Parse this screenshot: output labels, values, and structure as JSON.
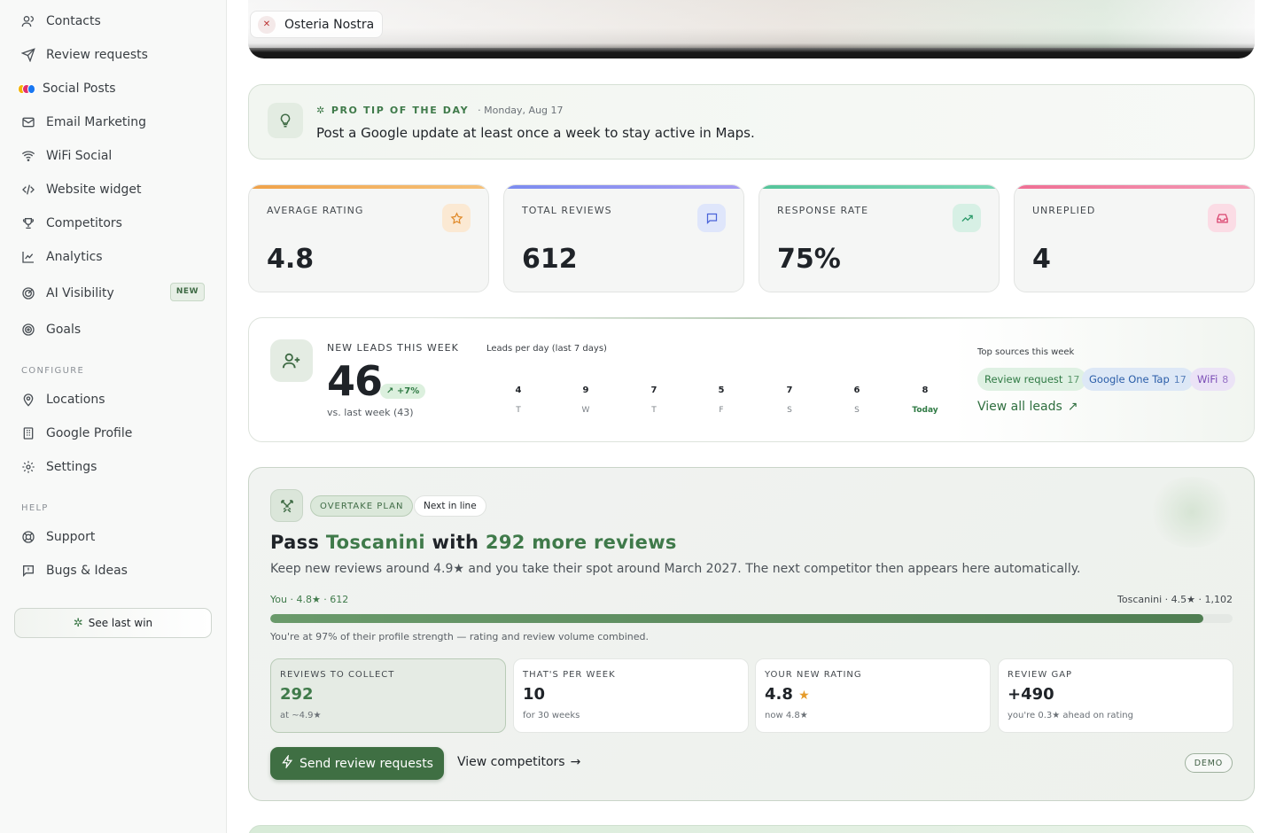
{
  "sidebar": {
    "items": [
      {
        "label": "Contacts",
        "icon": "contacts-icon"
      },
      {
        "label": "Review requests",
        "icon": "send-icon"
      },
      {
        "label": "Social Posts",
        "icon": "social-icons"
      },
      {
        "label": "Email Marketing",
        "icon": "mail-icon"
      },
      {
        "label": "WiFi Social",
        "icon": "wifi-icon"
      },
      {
        "label": "Website widget",
        "icon": "code-icon"
      },
      {
        "label": "Competitors",
        "icon": "trophy-icon"
      },
      {
        "label": "Analytics",
        "icon": "chart-icon"
      },
      {
        "label": "AI Visibility",
        "icon": "target-icon",
        "badge": "NEW"
      },
      {
        "label": "Goals",
        "icon": "goal-icon"
      }
    ],
    "configure_label": "CONFIGURE",
    "configure_items": [
      {
        "label": "Locations",
        "icon": "pin-icon"
      },
      {
        "label": "Google Profile",
        "icon": "building-icon"
      },
      {
        "label": "Settings",
        "icon": "gear-icon"
      }
    ],
    "help_label": "HELP",
    "help_items": [
      {
        "label": "Support",
        "icon": "lifebuoy-icon"
      },
      {
        "label": "Bugs & Ideas",
        "icon": "feedback-icon"
      }
    ],
    "see_last_win": "See last win"
  },
  "header": {
    "location_name": "Osteria Nostra"
  },
  "tip": {
    "label": "PRO TIP OF THE DAY",
    "date": "· Monday, Aug 17",
    "text": "Post a Google update at least once a week to stay active in Maps."
  },
  "stats": [
    {
      "label": "AVERAGE RATING",
      "value": "4.8",
      "color": "#f0a24a",
      "icon": "star-icon"
    },
    {
      "label": "TOTAL REVIEWS",
      "value": "612",
      "color": "#7b8cf0",
      "icon": "message-icon"
    },
    {
      "label": "RESPONSE RATE",
      "value": "75%",
      "color": "#54c49a",
      "icon": "trending-up-icon"
    },
    {
      "label": "UNREPLIED",
      "value": "4",
      "color": "#ef6f94",
      "icon": "inbox-icon"
    }
  ],
  "leads": {
    "label": "NEW LEADS THIS WEEK",
    "count": "46",
    "delta": "+7%",
    "vs": "vs. last week (43)",
    "chart_title": "Leads per day (last 7 days)",
    "days": [
      {
        "v": "4",
        "d": "T"
      },
      {
        "v": "9",
        "d": "W"
      },
      {
        "v": "7",
        "d": "T"
      },
      {
        "v": "5",
        "d": "F"
      },
      {
        "v": "7",
        "d": "S"
      },
      {
        "v": "6",
        "d": "S"
      },
      {
        "v": "8",
        "d": "Today"
      }
    ],
    "sources_title": "Top sources this week",
    "sources": [
      {
        "name": "Review request",
        "count": "17"
      },
      {
        "name": "Google One Tap",
        "count": "17"
      },
      {
        "name": "WiFi",
        "count": "8"
      }
    ],
    "view_all": "View all leads"
  },
  "plan": {
    "chip": "OVERTAKE PLAN",
    "next": "Next in line",
    "title_pre": "Pass ",
    "competitor": "Toscanini",
    "title_mid": " with ",
    "title_end": "292 more reviews",
    "desc": "Keep new reviews around 4.9★ and you take their spot around March 2027. The next competitor then appears here automatically.",
    "you": "You · 4.8★ · 612",
    "them": "Toscanini · 4.5★ · 1,102",
    "progress_percent": 97,
    "progress_note": "You're at 97% of their profile strength — rating and review volume combined.",
    "metrics": [
      {
        "label": "REVIEWS TO COLLECT",
        "value": "292",
        "sub": "at ~4.9★"
      },
      {
        "label": "THAT'S PER WEEK",
        "value": "10",
        "sub": "for 30 weeks"
      },
      {
        "label": "YOUR NEW RATING",
        "value": "4.8",
        "sub": "now 4.8★"
      },
      {
        "label": "REVIEW GAP",
        "value": "+490",
        "sub": "you're 0.3★ ahead on rating"
      }
    ],
    "send_button": "Send review requests",
    "view_competitors": "View competitors",
    "demo": "DEMO"
  }
}
